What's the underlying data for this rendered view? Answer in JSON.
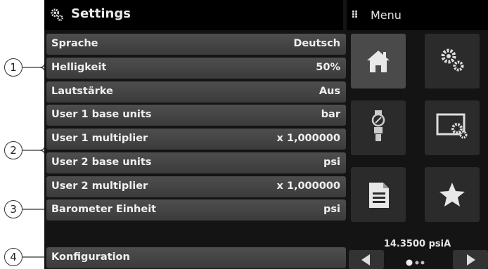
{
  "header": {
    "title": "Settings",
    "menu_label": "Menu"
  },
  "settings": [
    {
      "label": "Sprache",
      "value": "Deutsch"
    },
    {
      "label": "Helligkeit",
      "value": "50%"
    },
    {
      "label": "Lautstärke",
      "value": "Aus"
    },
    {
      "label": "User 1 base units",
      "value": "bar"
    },
    {
      "label": "User 1 multiplier",
      "value": "x 1,000000"
    },
    {
      "label": "User 2 base units",
      "value": "psi"
    },
    {
      "label": "User 2 multiplier",
      "value": "x 1,000000"
    },
    {
      "label": "Barometer Einheit",
      "value": "psi"
    },
    {
      "label": "Konfiguration",
      "value": ""
    }
  ],
  "callouts": [
    "1",
    "2",
    "3",
    "4"
  ],
  "menu_tiles": [
    "home-icon",
    "settings-gears-icon",
    "sensor-icon",
    "screen-settings-icon",
    "document-icon",
    "star-icon"
  ],
  "status": {
    "pressure": "14.3500 psiA"
  },
  "colors": {
    "screen_bg": "#141414",
    "row_bg": "#444444",
    "active_tile": "#4a4a4a",
    "tile": "#2b2b2b"
  }
}
